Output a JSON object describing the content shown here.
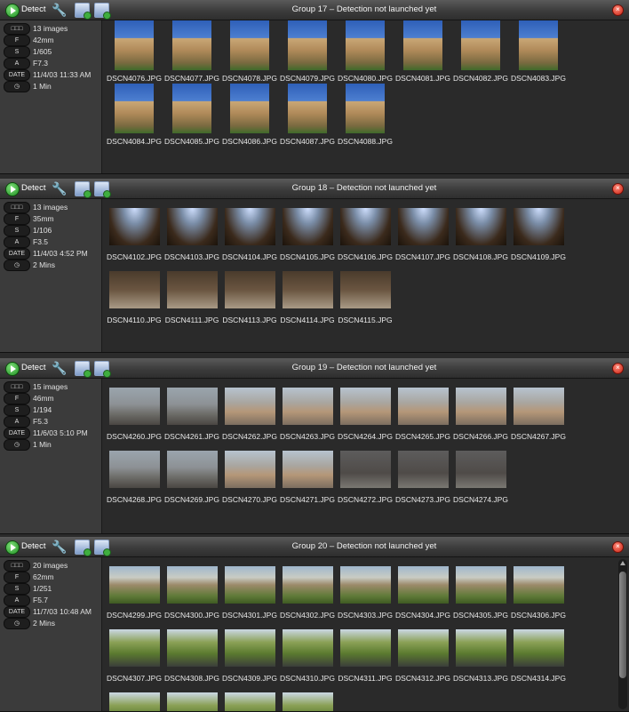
{
  "toolbar": {
    "detect_label": "Detect"
  },
  "groups": [
    {
      "title": "Group 17 – Detection not launched yet",
      "info": {
        "count": "13 images",
        "focal": "42mm",
        "shutter": "1/605",
        "aperture": "F7.3",
        "date": "11/4/03 11:33 AM",
        "duration": "1 Min"
      },
      "pills": {
        "grid": "□□□",
        "focal": "F",
        "shutter": "S",
        "aperture": "A",
        "date": "DATE",
        "duration": "◷"
      },
      "scene": "temple",
      "images": [
        "DSCN4076.JPG",
        "DSCN4077.JPG",
        "DSCN4078.JPG",
        "DSCN4079.JPG",
        "DSCN4080.JPG",
        "DSCN4081.JPG",
        "DSCN4082.JPG",
        "DSCN4083.JPG",
        "DSCN4084.JPG",
        "DSCN4085.JPG",
        "DSCN4086.JPG",
        "DSCN4087.JPG",
        "DSCN4088.JPG"
      ]
    },
    {
      "title": "Group 18 – Detection not launched yet",
      "info": {
        "count": "13 images",
        "focal": "35mm",
        "shutter": "1/106",
        "aperture": "F3.5",
        "date": "11/4/03 4:52 PM",
        "duration": "2 Mins"
      },
      "pills": {
        "grid": "□□□",
        "focal": "F",
        "shutter": "S",
        "aperture": "A",
        "date": "DATE",
        "duration": "◷"
      },
      "scene": "galleria",
      "images": [
        "DSCN4102.JPG",
        "DSCN4103.JPG",
        "DSCN4104.JPG",
        "DSCN4105.JPG",
        "DSCN4106.JPG",
        "DSCN4107.JPG",
        "DSCN4108.JPG",
        "DSCN4109.JPG",
        "DSCN4110.JPG",
        "DSCN4111.JPG",
        "DSCN4113.JPG",
        "DSCN4114.JPG",
        "DSCN4115.JPG"
      ]
    },
    {
      "title": "Group 19 – Detection not launched yet",
      "info": {
        "count": "15 images",
        "focal": "46mm",
        "shutter": "1/194",
        "aperture": "F5.3",
        "date": "11/6/03 5:10 PM",
        "duration": "1 Min"
      },
      "pills": {
        "grid": "□□□",
        "focal": "F",
        "shutter": "S",
        "aperture": "A",
        "date": "DATE",
        "duration": "◷"
      },
      "scene": "city",
      "images": [
        "DSCN4260.JPG",
        "DSCN4261.JPG",
        "DSCN4262.JPG",
        "DSCN4263.JPG",
        "DSCN4264.JPG",
        "DSCN4265.JPG",
        "DSCN4266.JPG",
        "DSCN4267.JPG",
        "DSCN4268.JPG",
        "DSCN4269.JPG",
        "DSCN4270.JPG",
        "DSCN4271.JPG",
        "DSCN4272.JPG",
        "DSCN4273.JPG",
        "DSCN4274.JPG"
      ]
    },
    {
      "title": "Group 20 – Detection not launched yet",
      "info": {
        "count": "20 images",
        "focal": "62mm",
        "shutter": "1/251",
        "aperture": "F5.7",
        "date": "11/7/03 10:48 AM",
        "duration": "2 Mins"
      },
      "pills": {
        "grid": "□□□",
        "focal": "F",
        "shutter": "S",
        "aperture": "A",
        "date": "DATE",
        "duration": "◷"
      },
      "scene": "arena",
      "images": [
        "DSCN4299.JPG",
        "DSCN4300.JPG",
        "DSCN4301.JPG",
        "DSCN4302.JPG",
        "DSCN4303.JPG",
        "DSCN4304.JPG",
        "DSCN4305.JPG",
        "DSCN4306.JPG",
        "DSCN4307.JPG",
        "DSCN4308.JPG",
        "DSCN4309.JPG",
        "DSCN4310.JPG",
        "DSCN4311.JPG",
        "DSCN4312.JPG",
        "DSCN4313.JPG",
        "DSCN4314.JPG",
        "",
        "",
        "",
        ""
      ]
    }
  ],
  "colors": {
    "close": "#d8261a",
    "play": "#2fa02f"
  },
  "icons": {
    "detect": "play-icon",
    "settings": "wrench-icon",
    "export": "export-image-icon",
    "add": "add-image-icon",
    "close": "close-icon"
  }
}
